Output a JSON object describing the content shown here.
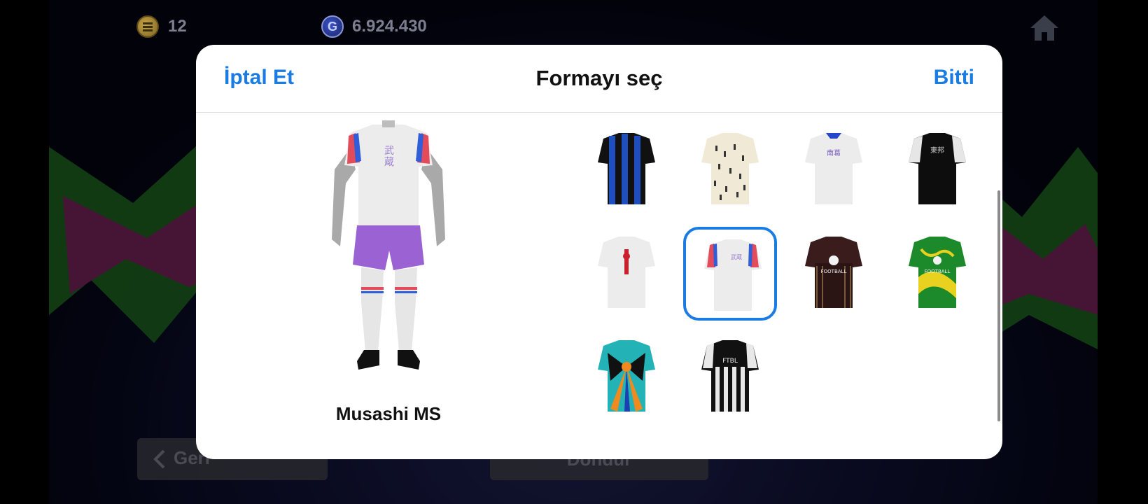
{
  "hud": {
    "coins": "12",
    "gp": "6.924.430",
    "gp_symbol": "G",
    "home_icon": "home-icon",
    "coin_icon": "coin-icon",
    "gp_icon": "gp-icon"
  },
  "background": {
    "back_button_label": "Geri",
    "rotate_button_label": "Döndür"
  },
  "dialog": {
    "cancel_label": "İptal Et",
    "title": "Formayı seç",
    "done_label": "Bitti",
    "selected_kit_name": "Musashi MS",
    "accent_color": "#1a7be3",
    "kits": [
      {
        "name": "blue-black-stripe-kit",
        "selected": false
      },
      {
        "name": "cream-pattern-kit",
        "selected": false
      },
      {
        "name": "white-blue-collar-kit",
        "selected": false
      },
      {
        "name": "black-white-sleeve-kit",
        "selected": false
      },
      {
        "name": "white-red-emblem-kit",
        "selected": false
      },
      {
        "name": "musashi-white-kit",
        "selected": true
      },
      {
        "name": "dark-maroon-efootball-kit",
        "selected": false
      },
      {
        "name": "green-yellow-efootball-kit",
        "selected": false
      },
      {
        "name": "teal-orange-pattern-kit",
        "selected": false
      },
      {
        "name": "black-white-stripe-kit",
        "selected": false
      }
    ]
  }
}
